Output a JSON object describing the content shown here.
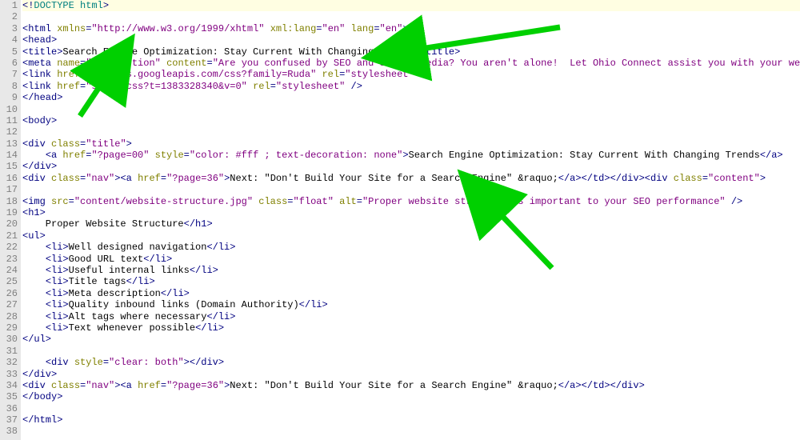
{
  "editor": {
    "highlighted_line": 1,
    "lines": [
      {
        "n": 1,
        "tokens": [
          {
            "c": "t-tag",
            "t": "<!"
          },
          {
            "c": "t-doc",
            "t": "DOCTYPE html"
          },
          {
            "c": "t-tag",
            "t": ">"
          }
        ]
      },
      {
        "n": 2,
        "tokens": []
      },
      {
        "n": 3,
        "tokens": [
          {
            "c": "t-tag",
            "t": "<html "
          },
          {
            "c": "t-attr",
            "t": "xmlns"
          },
          {
            "c": "t-tag",
            "t": "="
          },
          {
            "c": "t-val",
            "t": "\"http://www.w3.org/1999/xhtml\""
          },
          {
            "c": "t-tag",
            "t": " "
          },
          {
            "c": "t-attr",
            "t": "xml:lang"
          },
          {
            "c": "t-tag",
            "t": "="
          },
          {
            "c": "t-val",
            "t": "\"en\""
          },
          {
            "c": "t-tag",
            "t": " "
          },
          {
            "c": "t-attr",
            "t": "lang"
          },
          {
            "c": "t-tag",
            "t": "="
          },
          {
            "c": "t-val",
            "t": "\"en\""
          },
          {
            "c": "t-tag",
            "t": ">"
          }
        ]
      },
      {
        "n": 4,
        "tokens": [
          {
            "c": "t-tag",
            "t": "<head>"
          }
        ]
      },
      {
        "n": 5,
        "tokens": [
          {
            "c": "t-tag",
            "t": "<title>"
          },
          {
            "c": "t-text",
            "t": "Search Engine Optimization: Stay Current With Changing Trends"
          },
          {
            "c": "t-tag",
            "t": "</title>"
          }
        ]
      },
      {
        "n": 6,
        "tokens": [
          {
            "c": "t-tag",
            "t": "<meta "
          },
          {
            "c": "t-attr",
            "t": "name"
          },
          {
            "c": "t-tag",
            "t": "="
          },
          {
            "c": "t-val",
            "t": "\"description\""
          },
          {
            "c": "t-tag",
            "t": " "
          },
          {
            "c": "t-attr",
            "t": "content"
          },
          {
            "c": "t-tag",
            "t": "="
          },
          {
            "c": "t-val",
            "t": "\"Are you confused by SEO and social media? You aren't alone!  Let Ohio Connect assist you with your website marketing.\""
          },
          {
            "c": "t-tag",
            "t": " />"
          }
        ]
      },
      {
        "n": 7,
        "tokens": [
          {
            "c": "t-tag",
            "t": "<link "
          },
          {
            "c": "t-attr",
            "t": "href"
          },
          {
            "c": "t-tag",
            "t": "="
          },
          {
            "c": "t-val",
            "t": "\"//fonts.googleapis.com/css?family=Ruda\""
          },
          {
            "c": "t-tag",
            "t": " "
          },
          {
            "c": "t-attr",
            "t": "rel"
          },
          {
            "c": "t-tag",
            "t": "="
          },
          {
            "c": "t-val",
            "t": "\"stylesheet\""
          },
          {
            "c": "t-tag",
            "t": " />"
          }
        ]
      },
      {
        "n": 8,
        "tokens": [
          {
            "c": "t-tag",
            "t": "<link "
          },
          {
            "c": "t-attr",
            "t": "href"
          },
          {
            "c": "t-tag",
            "t": "="
          },
          {
            "c": "t-val",
            "t": "\"style.css?t=1383328340&v=0\""
          },
          {
            "c": "t-tag",
            "t": " "
          },
          {
            "c": "t-attr",
            "t": "rel"
          },
          {
            "c": "t-tag",
            "t": "="
          },
          {
            "c": "t-val",
            "t": "\"stylesheet\""
          },
          {
            "c": "t-tag",
            "t": " />"
          }
        ]
      },
      {
        "n": 9,
        "tokens": [
          {
            "c": "t-tag",
            "t": "</head>"
          }
        ]
      },
      {
        "n": 10,
        "tokens": []
      },
      {
        "n": 11,
        "tokens": [
          {
            "c": "t-tag",
            "t": "<body>"
          }
        ]
      },
      {
        "n": 12,
        "tokens": []
      },
      {
        "n": 13,
        "tokens": [
          {
            "c": "t-tag",
            "t": "<div "
          },
          {
            "c": "t-attr",
            "t": "class"
          },
          {
            "c": "t-tag",
            "t": "="
          },
          {
            "c": "t-val",
            "t": "\"title\""
          },
          {
            "c": "t-tag",
            "t": ">"
          }
        ]
      },
      {
        "n": 14,
        "tokens": [
          {
            "c": "t-text",
            "t": "    "
          },
          {
            "c": "t-tag",
            "t": "<a "
          },
          {
            "c": "t-attr",
            "t": "href"
          },
          {
            "c": "t-tag",
            "t": "="
          },
          {
            "c": "t-val",
            "t": "\"?page=00\""
          },
          {
            "c": "t-tag",
            "t": " "
          },
          {
            "c": "t-attr",
            "t": "style"
          },
          {
            "c": "t-tag",
            "t": "="
          },
          {
            "c": "t-val",
            "t": "\"color: #fff ; text-decoration: none\""
          },
          {
            "c": "t-tag",
            "t": ">"
          },
          {
            "c": "t-text",
            "t": "Search Engine Optimization: Stay Current With Changing Trends"
          },
          {
            "c": "t-tag",
            "t": "</a>"
          }
        ]
      },
      {
        "n": 15,
        "tokens": [
          {
            "c": "t-tag",
            "t": "</div>"
          }
        ]
      },
      {
        "n": 16,
        "tokens": [
          {
            "c": "t-tag",
            "t": "<div "
          },
          {
            "c": "t-attr",
            "t": "class"
          },
          {
            "c": "t-tag",
            "t": "="
          },
          {
            "c": "t-val",
            "t": "\"nav\""
          },
          {
            "c": "t-tag",
            "t": "><a "
          },
          {
            "c": "t-attr",
            "t": "href"
          },
          {
            "c": "t-tag",
            "t": "="
          },
          {
            "c": "t-val",
            "t": "\"?page=36\""
          },
          {
            "c": "t-tag",
            "t": ">"
          },
          {
            "c": "t-text",
            "t": "Next: \"Don't Build Your Site for a Search Engine\" &raquo;"
          },
          {
            "c": "t-tag",
            "t": "</a></td></div><div "
          },
          {
            "c": "t-attr",
            "t": "class"
          },
          {
            "c": "t-tag",
            "t": "="
          },
          {
            "c": "t-val",
            "t": "\"content\""
          },
          {
            "c": "t-tag",
            "t": ">"
          }
        ]
      },
      {
        "n": 17,
        "tokens": []
      },
      {
        "n": 18,
        "tokens": [
          {
            "c": "t-tag",
            "t": "<img "
          },
          {
            "c": "t-attr",
            "t": "src"
          },
          {
            "c": "t-tag",
            "t": "="
          },
          {
            "c": "t-val",
            "t": "\"content/website-structure.jpg\""
          },
          {
            "c": "t-tag",
            "t": " "
          },
          {
            "c": "t-attr",
            "t": "class"
          },
          {
            "c": "t-tag",
            "t": "="
          },
          {
            "c": "t-val",
            "t": "\"float\""
          },
          {
            "c": "t-tag",
            "t": " "
          },
          {
            "c": "t-attr",
            "t": "alt"
          },
          {
            "c": "t-tag",
            "t": "="
          },
          {
            "c": "t-val",
            "t": "\"Proper website structure is important to your SEO performance\""
          },
          {
            "c": "t-tag",
            "t": " />"
          }
        ]
      },
      {
        "n": 19,
        "tokens": [
          {
            "c": "t-tag",
            "t": "<h1>"
          }
        ]
      },
      {
        "n": 20,
        "tokens": [
          {
            "c": "t-text",
            "t": "    Proper Website Structure"
          },
          {
            "c": "t-tag",
            "t": "</h1>"
          }
        ]
      },
      {
        "n": 21,
        "tokens": [
          {
            "c": "t-tag",
            "t": "<ul>"
          }
        ]
      },
      {
        "n": 22,
        "tokens": [
          {
            "c": "t-text",
            "t": "    "
          },
          {
            "c": "t-tag",
            "t": "<li>"
          },
          {
            "c": "t-text",
            "t": "Well designed navigation"
          },
          {
            "c": "t-tag",
            "t": "</li>"
          }
        ]
      },
      {
        "n": 23,
        "tokens": [
          {
            "c": "t-text",
            "t": "    "
          },
          {
            "c": "t-tag",
            "t": "<li>"
          },
          {
            "c": "t-text",
            "t": "Good URL text"
          },
          {
            "c": "t-tag",
            "t": "</li>"
          }
        ]
      },
      {
        "n": 24,
        "tokens": [
          {
            "c": "t-text",
            "t": "    "
          },
          {
            "c": "t-tag",
            "t": "<li>"
          },
          {
            "c": "t-text",
            "t": "Useful internal links"
          },
          {
            "c": "t-tag",
            "t": "</li>"
          }
        ]
      },
      {
        "n": 25,
        "tokens": [
          {
            "c": "t-text",
            "t": "    "
          },
          {
            "c": "t-tag",
            "t": "<li>"
          },
          {
            "c": "t-text",
            "t": "Title tags"
          },
          {
            "c": "t-tag",
            "t": "</li>"
          }
        ]
      },
      {
        "n": 26,
        "tokens": [
          {
            "c": "t-text",
            "t": "    "
          },
          {
            "c": "t-tag",
            "t": "<li>"
          },
          {
            "c": "t-text",
            "t": "Meta description"
          },
          {
            "c": "t-tag",
            "t": "</li>"
          }
        ]
      },
      {
        "n": 27,
        "tokens": [
          {
            "c": "t-text",
            "t": "    "
          },
          {
            "c": "t-tag",
            "t": "<li>"
          },
          {
            "c": "t-text",
            "t": "Quality inbound links (Domain Authority)"
          },
          {
            "c": "t-tag",
            "t": "</li>"
          }
        ]
      },
      {
        "n": 28,
        "tokens": [
          {
            "c": "t-text",
            "t": "    "
          },
          {
            "c": "t-tag",
            "t": "<li>"
          },
          {
            "c": "t-text",
            "t": "Alt tags where necessary"
          },
          {
            "c": "t-tag",
            "t": "</li>"
          }
        ]
      },
      {
        "n": 29,
        "tokens": [
          {
            "c": "t-text",
            "t": "    "
          },
          {
            "c": "t-tag",
            "t": "<li>"
          },
          {
            "c": "t-text",
            "t": "Text whenever possible"
          },
          {
            "c": "t-tag",
            "t": "</li>"
          }
        ]
      },
      {
        "n": 30,
        "tokens": [
          {
            "c": "t-tag",
            "t": "</ul>"
          }
        ]
      },
      {
        "n": 31,
        "tokens": []
      },
      {
        "n": 32,
        "tokens": [
          {
            "c": "t-text",
            "t": "    "
          },
          {
            "c": "t-tag",
            "t": "<div "
          },
          {
            "c": "t-attr",
            "t": "style"
          },
          {
            "c": "t-tag",
            "t": "="
          },
          {
            "c": "t-val",
            "t": "\"clear: both\""
          },
          {
            "c": "t-tag",
            "t": "></div>"
          }
        ]
      },
      {
        "n": 33,
        "tokens": [
          {
            "c": "t-tag",
            "t": "</div>"
          }
        ]
      },
      {
        "n": 34,
        "tokens": [
          {
            "c": "t-tag",
            "t": "<div "
          },
          {
            "c": "t-attr",
            "t": "class"
          },
          {
            "c": "t-tag",
            "t": "="
          },
          {
            "c": "t-val",
            "t": "\"nav\""
          },
          {
            "c": "t-tag",
            "t": "><a "
          },
          {
            "c": "t-attr",
            "t": "href"
          },
          {
            "c": "t-tag",
            "t": "="
          },
          {
            "c": "t-val",
            "t": "\"?page=36\""
          },
          {
            "c": "t-tag",
            "t": ">"
          },
          {
            "c": "t-text",
            "t": "Next: \"Don't Build Your Site for a Search Engine\" &raquo;"
          },
          {
            "c": "t-tag",
            "t": "</a></td></div>"
          }
        ]
      },
      {
        "n": 35,
        "tokens": [
          {
            "c": "t-tag",
            "t": "</body>"
          }
        ]
      },
      {
        "n": 36,
        "tokens": []
      },
      {
        "n": 37,
        "tokens": [
          {
            "c": "t-tag",
            "t": "</html>"
          }
        ]
      },
      {
        "n": 38,
        "tokens": []
      }
    ]
  },
  "arrows": {
    "color": "#00D000"
  }
}
